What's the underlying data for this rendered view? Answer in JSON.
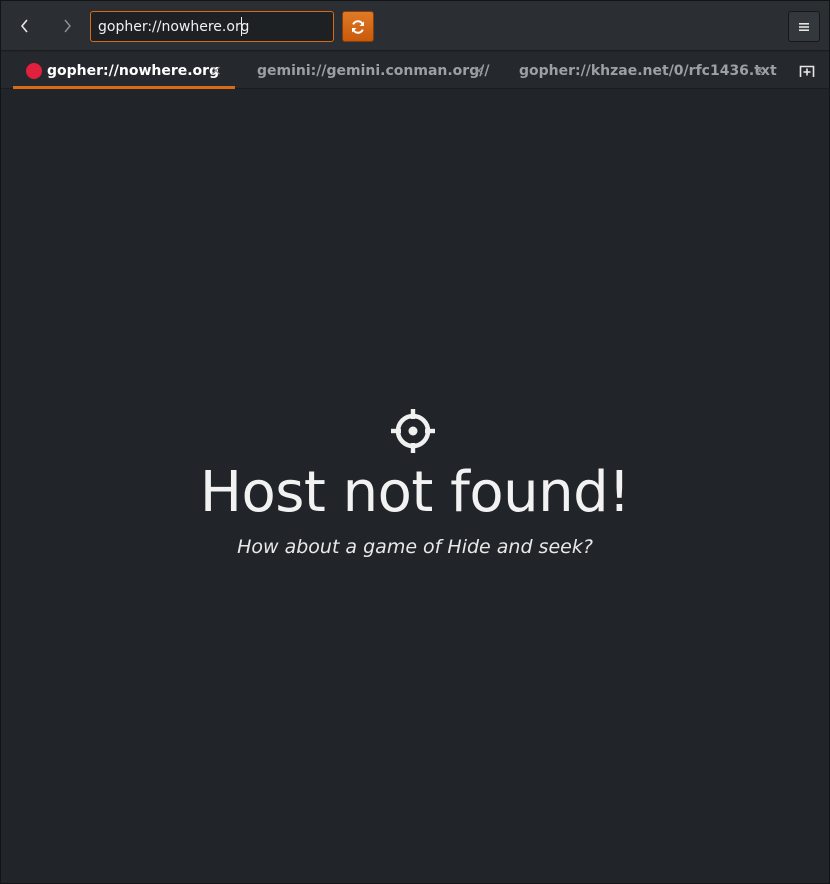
{
  "header": {
    "url_value": "gopher://nowhere.org",
    "back_icon": "chevron-left-icon",
    "forward_icon": "chevron-right-icon",
    "reload_icon": "reload-icon",
    "menu_icon": "hamburger-menu-icon"
  },
  "tabs": [
    {
      "label": "gopher://nowhere.org",
      "active": true,
      "status": "error"
    },
    {
      "label": "gemini://gemini.conman.org//",
      "active": false
    },
    {
      "label": "gopher://khzae.net/0/rfc1436.txt",
      "active": false
    }
  ],
  "tab_close_glyph": "×",
  "error": {
    "icon": "crosshair-icon",
    "title": "Host not found!",
    "subtitle": "How about a game of Hide and seek?"
  },
  "colors": {
    "accent": "#d96a16",
    "error_dot": "#e0203d",
    "background": "#212529"
  }
}
